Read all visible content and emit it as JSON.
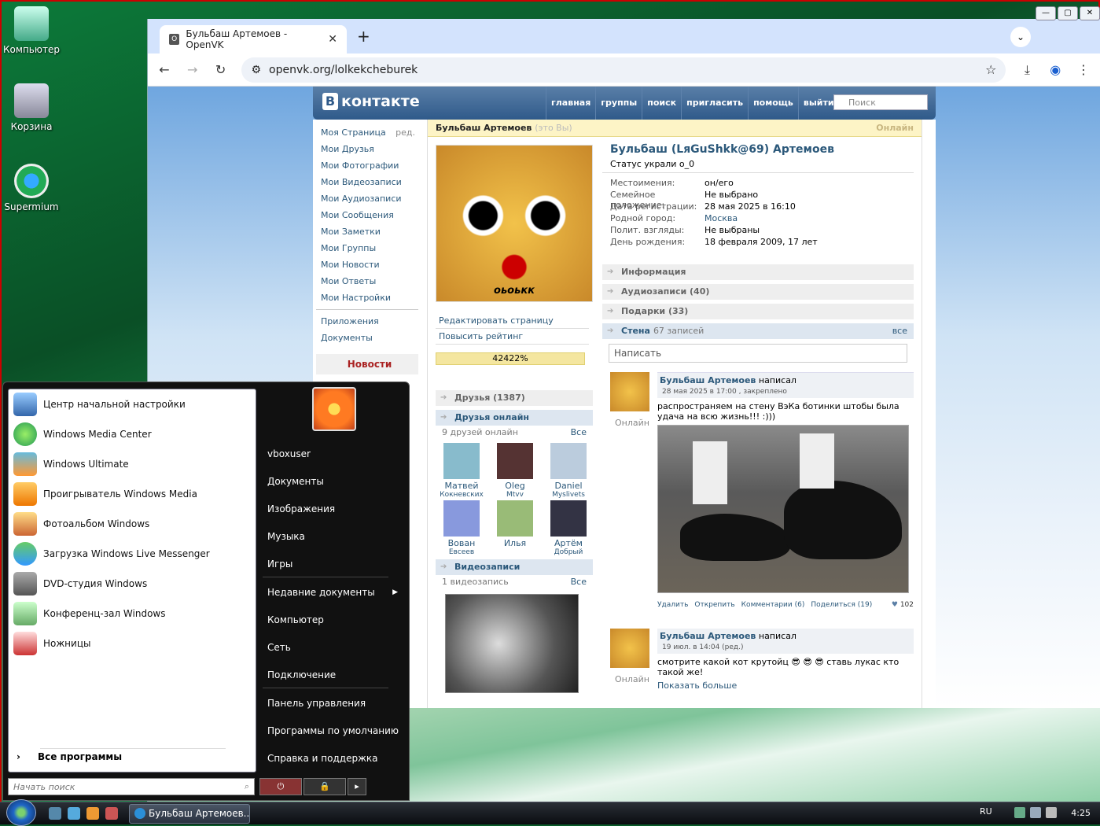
{
  "desktop": {
    "icons": [
      {
        "label": "Компьютер"
      },
      {
        "label": "Корзина"
      },
      {
        "label": "Supermium"
      }
    ]
  },
  "browser": {
    "tab_title": "Бульбаш Артемоев - OpenVK",
    "favicon": "O",
    "url": "openvk.org/lolkekcheburek"
  },
  "vk": {
    "logo": "контакте",
    "logo_b": "В",
    "nav": [
      "главная",
      "группы",
      "поиск",
      "пригласить",
      "помощь",
      "выйти"
    ],
    "search_placeholder": "Поиск",
    "left_menu": [
      "Моя Страница",
      "Мои Друзья",
      "Мои Фотографии",
      "Мои Видеозаписи",
      "Мои Аудиозаписи",
      "Мои Сообщения",
      "Мои Заметки",
      "Мои Группы",
      "Мои Новости",
      "Мои Ответы",
      "Мои Настройки"
    ],
    "edit_label": "ред.",
    "left_menu2": [
      "Приложения",
      "Документы"
    ],
    "news_label": "Новости",
    "profile_bar_name": "Бульбаш Артемоев",
    "profile_bar_me": "(это Вы)",
    "profile_bar_online": "Онлайн",
    "avatar_caption": "оьоькк",
    "profile_links": [
      "Редактировать страницу",
      "Повысить рейтинг"
    ],
    "rating": "42422%",
    "friends_section": "Друзья (1387)",
    "friends_online_section": "Друзья онлайн",
    "friends_online_count": "9 друзей онлайн",
    "all_label": "Все",
    "friends": [
      {
        "name": "Матвей",
        "sub": "Кокневских"
      },
      {
        "name": "Oleg",
        "sub": "Mtvv"
      },
      {
        "name": "Daniel",
        "sub": "Myslivets"
      },
      {
        "name": "Вован",
        "sub": "Евсеев"
      },
      {
        "name": "Илья",
        "sub": ""
      },
      {
        "name": "Артём",
        "sub": "Добрый"
      }
    ],
    "videos_section": "Видеозаписи",
    "videos_count": "1 видеозапись",
    "full_name": "Бульбаш (LяGuShkk@69) Артемоев",
    "status": "Статус украли о_0",
    "info": [
      {
        "k": "Местоимения:",
        "v": "он/его"
      },
      {
        "k": "Семейное положение:",
        "v": "Не выбрано"
      },
      {
        "k": "Дата регистрации:",
        "v": "28 мая 2025 в 16:10"
      },
      {
        "k": "Родной город:",
        "v": "Москва"
      },
      {
        "k": "Полит. взгляды:",
        "v": "Не выбраны"
      },
      {
        "k": "День рождения:",
        "v": "18 февраля 2009, 17 лет"
      }
    ],
    "sections": [
      "Информация",
      "Аудиозаписи (40)",
      "Подарки (33)"
    ],
    "wall_label": "Стена",
    "wall_count": "67 записей",
    "wall_all": "все",
    "wall_placeholder": "Написать",
    "post1": {
      "author": "Бульбаш Артемоев",
      "verb": "написал",
      "date": "28 мая 2025 в 17:00 , закреплено",
      "online": "Онлайн",
      "text": "распространяем на стену ВэКа ботинки штобы была удача на всю жизнь!!! :)))",
      "actions": [
        "Удалить",
        "Открепить",
        "Комментарии (6)",
        "Поделиться (19)"
      ],
      "likes": "102"
    },
    "post2": {
      "author": "Бульбаш Артемоев",
      "verb": "написал",
      "date": "19 июл. в 14:04 (ред.)",
      "online": "Онлайн",
      "text": "смотрите какой кот крутойц 😎 😎 😎 ставь лукас кто такой же!",
      "more": "Показать больше"
    }
  },
  "start_menu": {
    "left_items": [
      "Центр начальной настройки",
      "Windows Media Center",
      "Windows Ultimate",
      "Проигрыватель Windows Media",
      "Фотоальбом Windows",
      "Загрузка Windows Live Messenger",
      "DVD-студия Windows",
      "Конференц-зал Windows",
      "Ножницы"
    ],
    "all_programs": "Все программы",
    "search_placeholder": "Начать поиск",
    "right_items": [
      "vboxuser",
      "Документы",
      "Изображения",
      "Музыка",
      "Игры",
      "Недавние документы",
      "Компьютер",
      "Сеть",
      "Подключение",
      "Панель управления",
      "Программы по умолчанию",
      "Справка и поддержка"
    ]
  },
  "taskbar": {
    "window": "Бульбаш Артемоев...",
    "lang": "RU",
    "clock": "4:25"
  }
}
